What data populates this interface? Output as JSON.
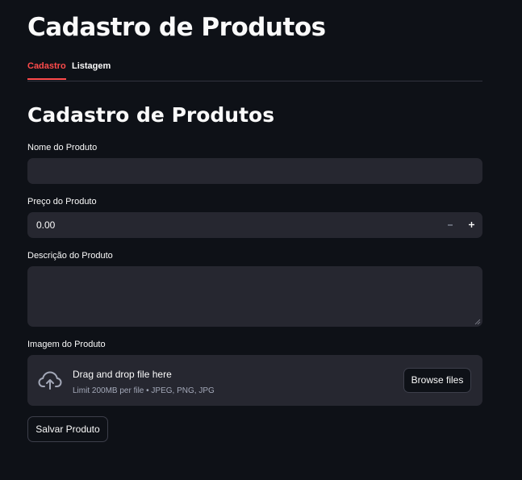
{
  "page": {
    "title": "Cadastro de Produtos"
  },
  "tabs": [
    {
      "label": "Cadastro",
      "active": true
    },
    {
      "label": "Listagem",
      "active": false
    }
  ],
  "form": {
    "section_title": "Cadastro de Produtos",
    "name": {
      "label": "Nome do Produto",
      "value": ""
    },
    "price": {
      "label": "Preço do Produto",
      "value": "0.00",
      "decrement_icon": "minus-icon",
      "increment_icon": "plus-icon"
    },
    "description": {
      "label": "Descrição do Produto",
      "value": ""
    },
    "image": {
      "label": "Imagem do Produto",
      "drop_title": "Drag and drop file here",
      "drop_limit": "Limit 200MB per file • JPEG, PNG, JPG",
      "browse_label": "Browse files",
      "icon": "cloud-upload-icon"
    },
    "submit_label": "Salvar Produto"
  },
  "colors": {
    "background": "#0e1117",
    "field_background": "#262730",
    "accent": "#ff4b4b",
    "text": "#fafafa"
  }
}
